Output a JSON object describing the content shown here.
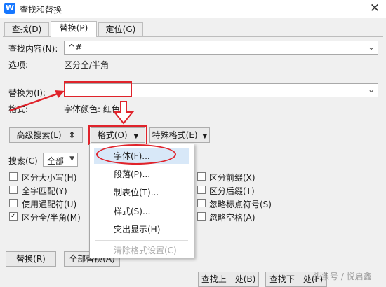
{
  "window": {
    "title": "查找和替换",
    "app_icon": "W"
  },
  "tabs": [
    {
      "label": "查找(D)"
    },
    {
      "label": "替换(P)"
    },
    {
      "label": "定位(G)"
    }
  ],
  "find": {
    "label": "查找内容(N):",
    "value": "^#",
    "options_label": "选项:",
    "options_value": "区分全/半角"
  },
  "replace": {
    "label": "替换为(I):",
    "value": "",
    "format_label": "格式:",
    "format_value": "字体颜色: 红色"
  },
  "toolbar": {
    "advanced_search": "高级搜索(L)",
    "format": "格式(O)",
    "special_format": "特殊格式(E)"
  },
  "search": {
    "label": "搜索(C)",
    "value": "全部"
  },
  "checkboxes_left": [
    {
      "label": "区分大小写(H)",
      "checked": false
    },
    {
      "label": "全字匹配(Y)",
      "checked": false
    },
    {
      "label": "使用通配符(U)",
      "checked": false
    },
    {
      "label": "区分全/半角(M)",
      "checked": true
    }
  ],
  "checkboxes_right": [
    {
      "label": "区分前缀(X)",
      "checked": false
    },
    {
      "label": "区分后缀(T)",
      "checked": false
    },
    {
      "label": "忽略标点符号(S)",
      "checked": false
    },
    {
      "label": "忽略空格(A)",
      "checked": false
    }
  ],
  "format_menu": [
    {
      "label": "字体(F)...",
      "disabled": false,
      "highlighted": true
    },
    {
      "label": "段落(P)...",
      "disabled": false
    },
    {
      "label": "制表位(T)...",
      "disabled": false
    },
    {
      "label": "样式(S)...",
      "disabled": false
    },
    {
      "label": "突出显示(H)",
      "disabled": false
    },
    {
      "label": "清除格式设置(C)",
      "disabled": true
    }
  ],
  "buttons": {
    "replace": "替换(R)",
    "replace_all": "全部替换(A)",
    "find_prev": "查找上一处(B)",
    "find_next": "查找下一处(F)"
  },
  "watermark": "头条号 / 悦启鑫",
  "colors": {
    "annotation": "#e0232b",
    "app_icon": "#1677ff",
    "menu_highlight": "#d8e8f8"
  }
}
